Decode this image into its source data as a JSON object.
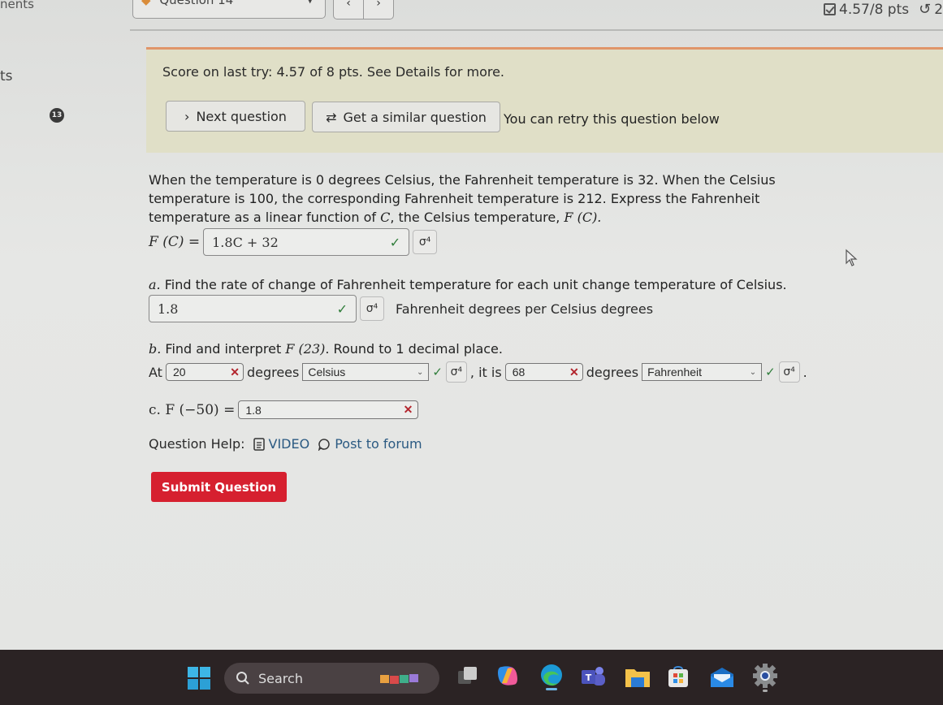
{
  "topbar": {
    "crumb": "nents",
    "question_select": "Question 14",
    "prev_glyph": "‹",
    "next_glyph": "›",
    "points": "4.57/8 pts",
    "retry_glyph": "↺",
    "retry_count": "2"
  },
  "sidebar": {
    "label": "ts",
    "badge": "13"
  },
  "score_panel": {
    "score_text": "Score on last try: 4.57 of 8 pts. See Details for more.",
    "next_button": "Next question",
    "similar_button": "Get a similar question",
    "retry_note": "You can retry this question below"
  },
  "question": {
    "body_1": "When the temperature is 0 degrees Celsius, the Fahrenheit temperature is 32. When the Celsius temperature is 100, the corresponding Fahrenheit temperature is 212. Express the Fahrenheit temperature as a linear function of ",
    "body_var": "C",
    "body_2": ", the Celsius temperature, ",
    "body_fn": "F (C).",
    "fc_label": "F (C) =",
    "fc_answer": "1.8C + 32",
    "fc_status": "✓",
    "part_a_prefix": "a.",
    "part_a_text": " Find the rate of change of Fahrenheit temperature for each unit change temperature of Celsius.",
    "part_a_answer": "1.8",
    "part_a_status": "✓",
    "part_a_units": "Fahrenheit degrees per Celsius degrees",
    "part_b_prefix": "b.",
    "part_b_text_1": " Find and interpret ",
    "part_b_fn": "F (23)",
    "part_b_text_2": ". Round to 1 decimal place.",
    "part_b_at": "At",
    "part_b_input1": "20",
    "part_b_input1_status": "✕",
    "part_b_degrees1": "degrees",
    "part_b_select1": "Celsius",
    "part_b_select1_status": "✓",
    "part_b_itis": ", it is",
    "part_b_input2": "68",
    "part_b_input2_status": "✕",
    "part_b_degrees2": "degrees",
    "part_b_select2": "Fahrenheit",
    "part_b_select2_status": "✓",
    "part_b_end": ".",
    "part_c_label": "c. F (−50) =",
    "part_c_answer": "1.8",
    "part_c_status": "✕",
    "symbol_glyph": "σ⁴"
  },
  "help": {
    "label": "Question Help:",
    "video": "VIDEO",
    "forum": "Post to forum"
  },
  "submit_button": "Submit Question",
  "taskbar": {
    "search": "Search"
  },
  "colors": {
    "submit": "#d6202f",
    "correct": "#2f7d3a",
    "incorrect": "#b3262e",
    "score_panel_bg": "#e0dfc7",
    "link": "#2b5a82"
  }
}
